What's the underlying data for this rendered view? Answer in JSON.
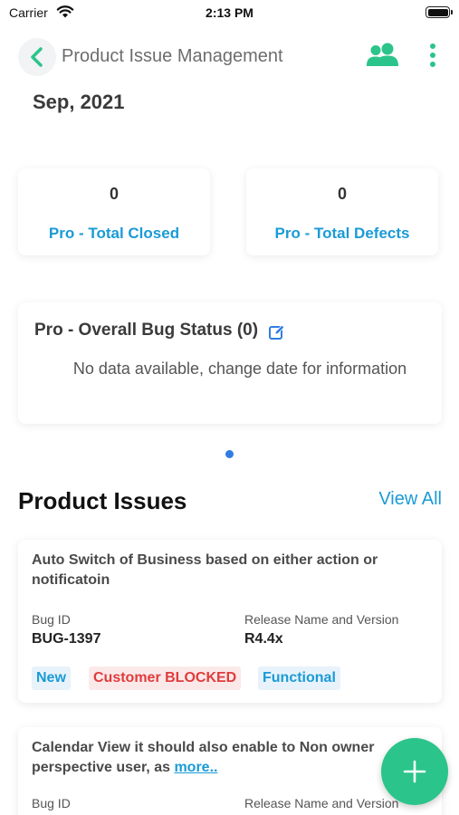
{
  "status_bar": {
    "carrier": "Carrier",
    "time": "2:13 PM"
  },
  "header": {
    "title": "Product Issue Management"
  },
  "date": "Sep, 2021",
  "stats": [
    {
      "value": "0",
      "label": "Pro - Total Closed"
    },
    {
      "value": "0",
      "label": "Pro - Total Defects"
    }
  ],
  "bug_status": {
    "title": "Pro - Overall Bug Status (0)",
    "empty_message": "No data available, change date for information"
  },
  "issues_section": {
    "title": "Product Issues",
    "view_all": "View All"
  },
  "issues": [
    {
      "title": "Auto Switch of Business based on either action or notificatoin",
      "bug_id_label": "Bug ID",
      "bug_id": "BUG-1397",
      "release_label": "Release Name and Version",
      "release": "R4.4x",
      "badges": [
        "New",
        "Customer BLOCKED",
        "Functional"
      ]
    },
    {
      "title": "Calendar View it should also enable to Non owner perspective user, as",
      "more": "more..",
      "bug_id_label": "Bug ID",
      "release_label": "Release Name and Version"
    }
  ],
  "colors": {
    "accent_green": "#2bc48a",
    "link_blue": "#1a9bd6",
    "blocked_red": "#e03c3c"
  },
  "icons": [
    "wifi-icon",
    "battery-icon",
    "back-chevron-icon",
    "team-icon",
    "more-vertical-icon",
    "edit-icon",
    "plus-icon"
  ]
}
